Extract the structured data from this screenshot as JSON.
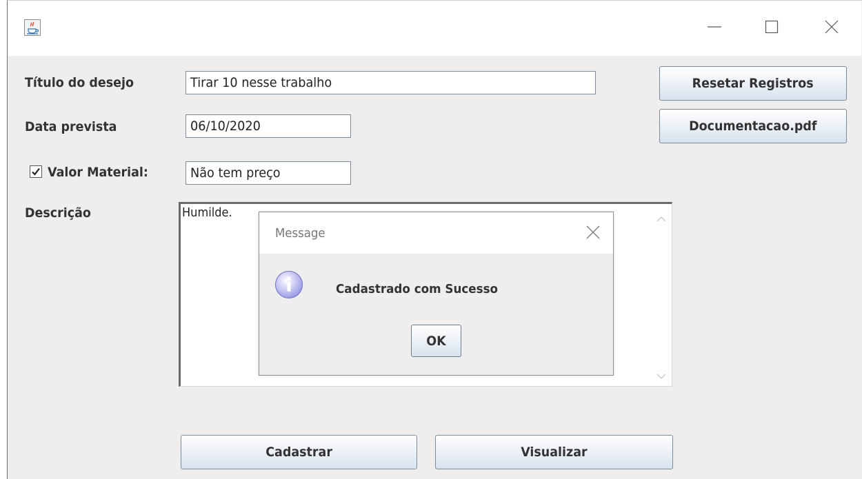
{
  "window": {
    "icon": "java-coffee-icon",
    "controls": [
      "minimize-icon",
      "maximize-icon",
      "close-icon"
    ]
  },
  "form": {
    "titulo_label": "Título do desejo",
    "titulo_value": "Tirar 10 nesse trabalho",
    "data_label": "Data prevista",
    "data_value": "06/10/2020",
    "valor_checked": true,
    "valor_label": "Valor Material:",
    "valor_value": "Não tem preço",
    "descricao_label": "Descrição",
    "descricao_value": "Humilde."
  },
  "buttons": {
    "reset": "Resetar Registros",
    "docs": "Documentacao.pdf",
    "cadastrar": "Cadastrar",
    "visualizar": "Visualizar"
  },
  "dialog": {
    "title": "Message",
    "icon": "info-icon",
    "message": "Cadastrado com Sucesso",
    "ok": "OK"
  },
  "colors": {
    "window_bg": "#eeeeee",
    "button_gradient_end": "#d7e3ee",
    "info_icon": "#9d9de6"
  }
}
